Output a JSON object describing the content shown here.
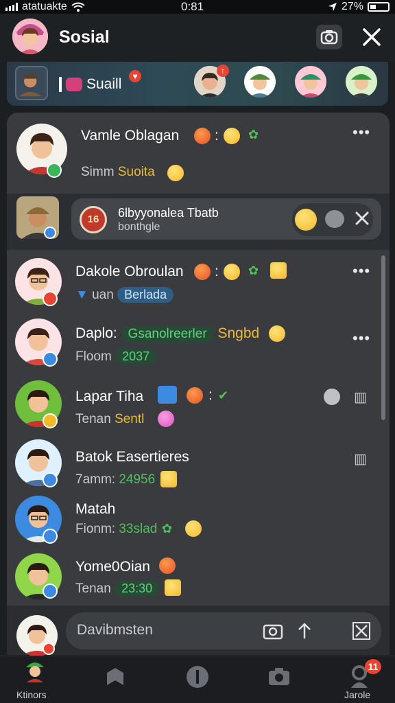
{
  "status_bar": {
    "carrier": "atatuakte",
    "time": "0:81",
    "battery": "27%"
  },
  "header": {
    "title": "Sosial"
  },
  "stories": {
    "label": "Suaill"
  },
  "chats": [
    {
      "name": "Vamle Oblagan",
      "sub": "Simm",
      "tag": "Suoita"
    },
    {
      "notif_title": "6lbyyonalea Tbatb",
      "notif_sub": "bonthgle",
      "notif_badge": "16"
    },
    {
      "name": "Dakole Obroulan",
      "sub": "uan",
      "pill": "Berlada"
    },
    {
      "name": "Daplo:",
      "name_tag": "Gsanolreerler",
      "name_tag2": "Sngbd",
      "sub": "Floom",
      "pill": "2037"
    },
    {
      "name": "Lapar Tiha",
      "sub": "Tenan",
      "tag": "Sentl"
    },
    {
      "name": "Batok Easertieres",
      "sub": "7amm:",
      "tag": "24956"
    },
    {
      "name": "Matah",
      "sub": "Fionm:",
      "tag": "33slad"
    },
    {
      "name": "Yome0Oian",
      "sub": "Tenan",
      "pill": "23:30"
    }
  ],
  "composer": {
    "placeholder": "Davibmsten"
  },
  "nav": {
    "left_label": "Ktinors",
    "right_label": "Jarole",
    "badge": "11"
  }
}
